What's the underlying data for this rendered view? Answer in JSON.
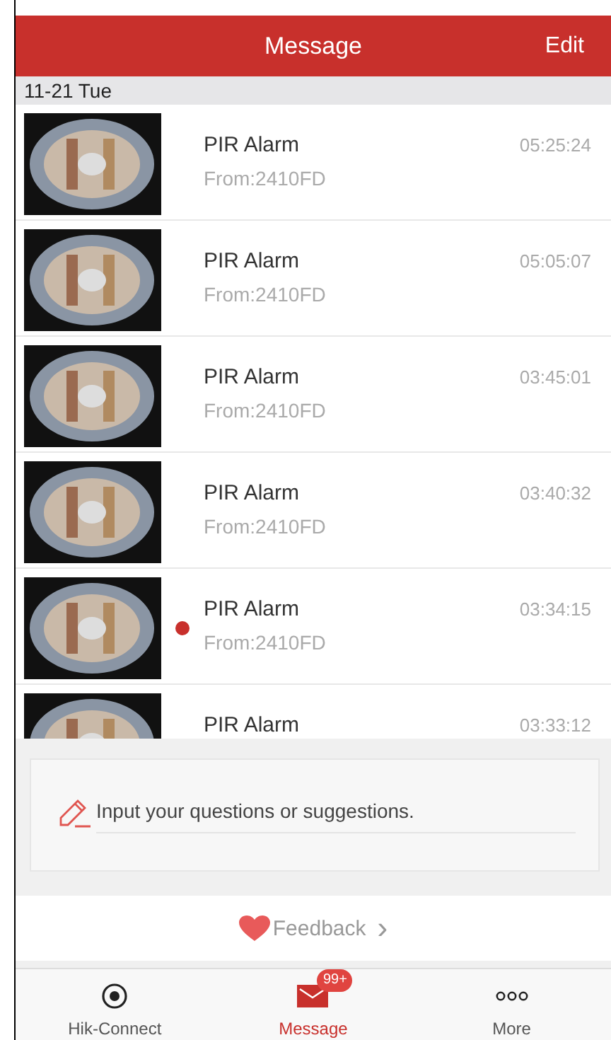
{
  "header": {
    "title": "Message",
    "action": "Edit"
  },
  "date_header": "11-21 Tue",
  "messages": [
    {
      "title": "PIR Alarm",
      "source": "From:2410FD",
      "time": "05:25:24",
      "unread": false
    },
    {
      "title": "PIR Alarm",
      "source": "From:2410FD",
      "time": "05:05:07",
      "unread": false
    },
    {
      "title": "PIR Alarm",
      "source": "From:2410FD",
      "time": "03:45:01",
      "unread": false
    },
    {
      "title": "PIR Alarm",
      "source": "From:2410FD",
      "time": "03:40:32",
      "unread": false
    },
    {
      "title": "PIR Alarm",
      "source": "From:2410FD",
      "time": "03:34:15",
      "unread": true
    },
    {
      "title": "PIR Alarm",
      "time": "03:33:12",
      "unread": false
    }
  ],
  "feedback": {
    "placeholder": "Input your questions or suggestions.",
    "link": "Feedback",
    "chevron": "›"
  },
  "tabs": [
    {
      "kind": "target",
      "label": "Hik-Connect",
      "selected": false
    },
    {
      "kind": "mail",
      "label": "Message",
      "selected": true,
      "badge": "99+"
    },
    {
      "kind": "dots",
      "label": "More",
      "selected": false
    }
  ]
}
